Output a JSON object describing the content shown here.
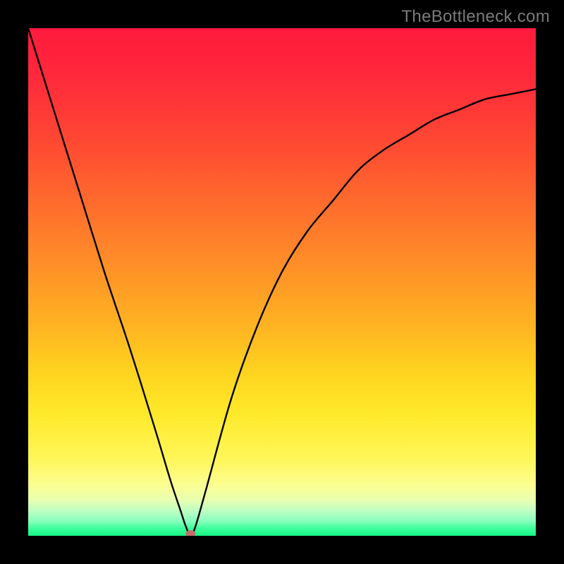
{
  "credit_text": "TheBottleneck.com",
  "chart_data": {
    "type": "line",
    "title": "",
    "xlabel": "",
    "ylabel": "",
    "xlim": [
      0,
      100
    ],
    "ylim": [
      0,
      100
    ],
    "x": [
      0,
      5,
      10,
      15,
      20,
      25,
      28,
      30,
      31,
      32,
      33,
      35,
      40,
      45,
      50,
      55,
      60,
      65,
      70,
      75,
      80,
      85,
      90,
      95,
      100
    ],
    "values": [
      100,
      84,
      68,
      52,
      37,
      21,
      11,
      5,
      2,
      0,
      2,
      9,
      27,
      41,
      52,
      60,
      66,
      72,
      76,
      79,
      82,
      84,
      86,
      87,
      88
    ],
    "optimum_x": 32,
    "optimum_y": 0,
    "gradient_stops": [
      {
        "offset": 0.0,
        "color": "#ff1a3d"
      },
      {
        "offset": 0.5,
        "color": "#ffa623"
      },
      {
        "offset": 0.8,
        "color": "#fff14a"
      },
      {
        "offset": 0.95,
        "color": "#bfffc2"
      },
      {
        "offset": 1.0,
        "color": "#15f585"
      }
    ]
  }
}
